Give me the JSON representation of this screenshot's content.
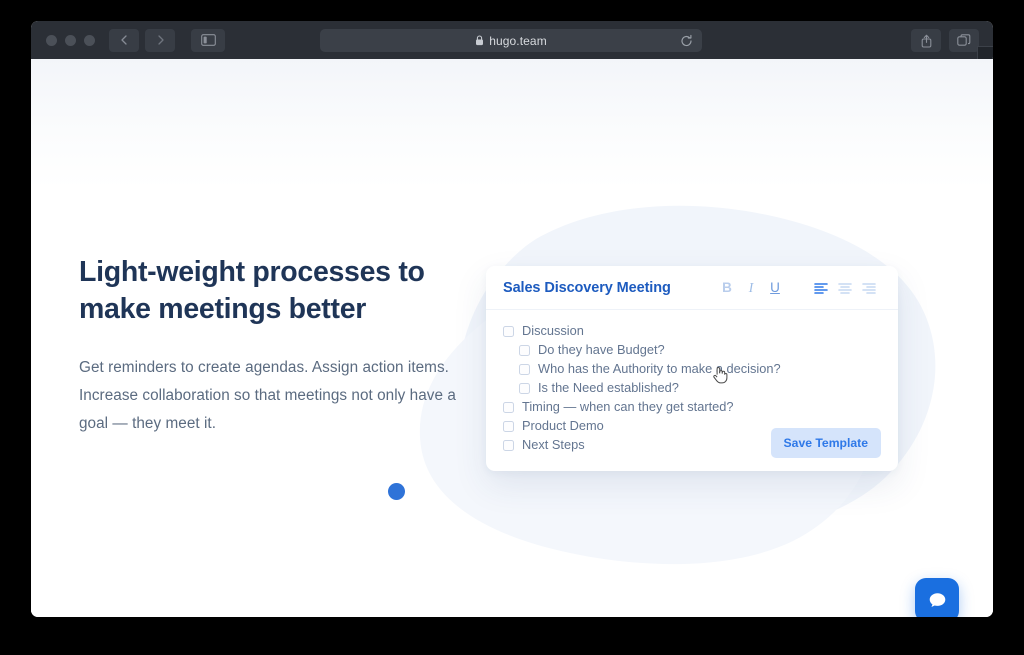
{
  "browser": {
    "url": "hugo.team",
    "lock_icon": "lock-icon",
    "reload_icon": "reload-icon",
    "back_icon": "chevron-left-icon",
    "forward_icon": "chevron-right-icon",
    "sidebar_icon": "sidebar-toggle-icon",
    "share_icon": "share-icon",
    "tabs_icon": "tab-overview-icon",
    "newtab_label": "+",
    "chrome_bg": "#2b2f36"
  },
  "hero": {
    "title": "Light-weight processes to make meetings better",
    "body": "Get reminders to create agendas. Assign action items. Increase collaboration so that meetings not only have a goal — they meet it.",
    "dot_color": "#2f73d8"
  },
  "card": {
    "title": "Sales Discovery Meeting",
    "title_color": "#1d5bbf",
    "toolbar": [
      {
        "name": "bold-button",
        "label": "B",
        "active": false
      },
      {
        "name": "italic-button",
        "label": "I",
        "active": false
      },
      {
        "name": "underline-button",
        "label": "U",
        "active": false
      },
      {
        "name": "align-left-button",
        "label": "align-left-icon",
        "active": true
      },
      {
        "name": "align-center-button",
        "label": "align-center-icon",
        "active": false
      },
      {
        "name": "align-right-button",
        "label": "align-right-icon",
        "active": false
      }
    ],
    "checklist": [
      {
        "label": "Discussion",
        "checked": false,
        "indent": 0
      },
      {
        "label": "Do they have Budget?",
        "checked": false,
        "indent": 1
      },
      {
        "label": "Who has the Authority to make a decision?",
        "checked": false,
        "indent": 1
      },
      {
        "label": "Is the Need established?",
        "checked": false,
        "indent": 1
      },
      {
        "label": "Timing — when can they get started?",
        "checked": false,
        "indent": 0
      },
      {
        "label": "Product Demo",
        "checked": false,
        "indent": 0
      },
      {
        "label": "Next Steps",
        "checked": false,
        "indent": 0
      }
    ],
    "save_label": "Save Template",
    "save_bg": "#d5e4fb",
    "save_color": "#2f79e8"
  },
  "chat": {
    "icon": "chat-bubble-icon",
    "color": "#1a6fe0"
  },
  "cursor": {
    "icon": "pointing-hand-cursor"
  }
}
